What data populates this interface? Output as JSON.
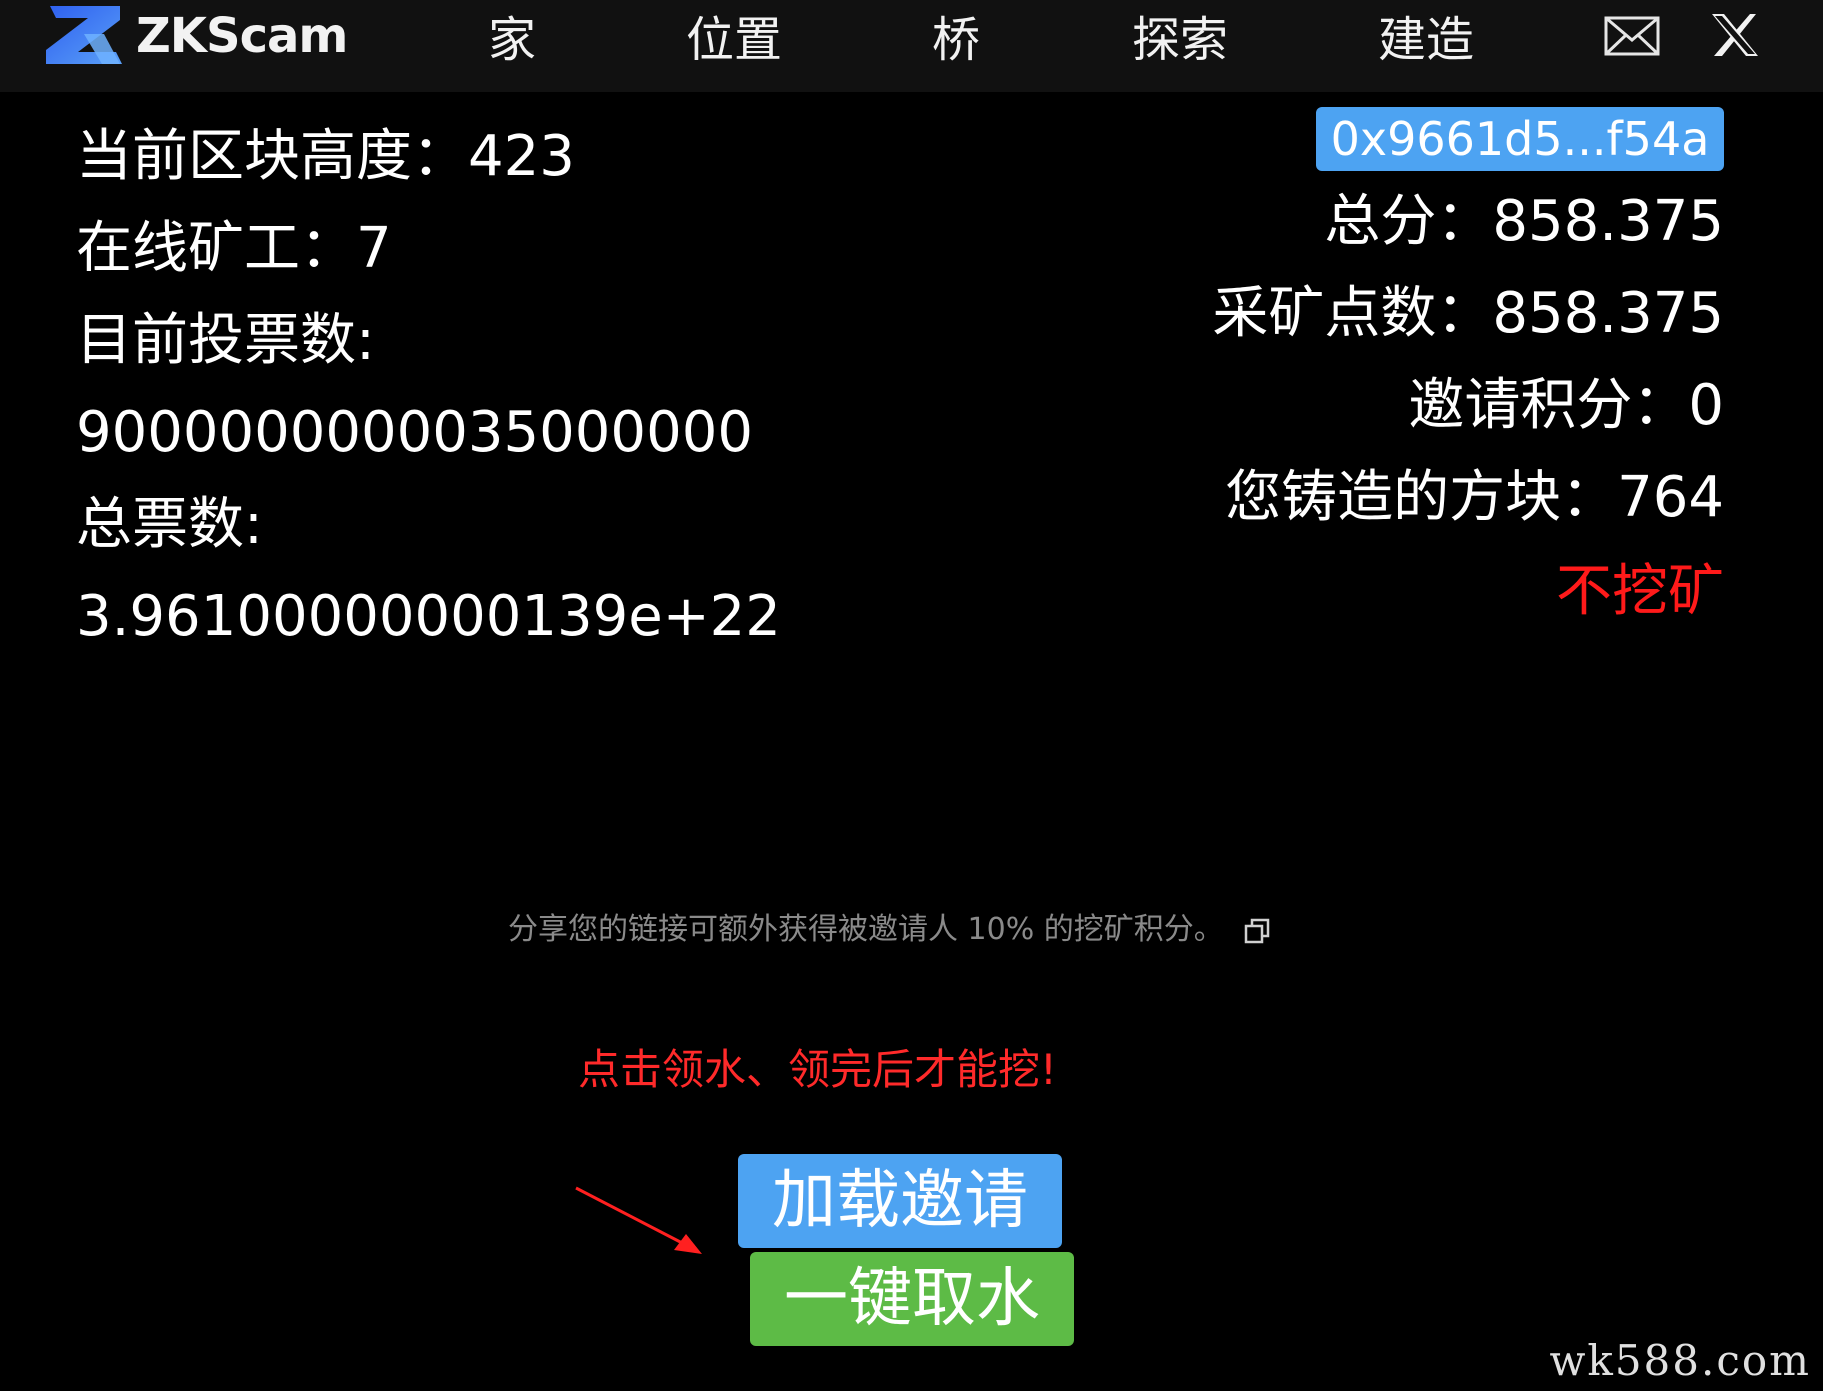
{
  "header": {
    "brand": "ZKScam",
    "nav": [
      "家",
      "位置",
      "桥",
      "探索",
      "建造"
    ],
    "icons": [
      "zkscam-logo-icon",
      "mail-icon",
      "x-icon"
    ]
  },
  "stats_left": {
    "block_height": "当前区块高度：423",
    "online_miners": "在线矿工：7",
    "current_votes_label": "目前投票数:",
    "current_votes_value": "9000000000035000000",
    "total_votes_label": "总票数:",
    "total_votes_value": "3.96100000000139e+22"
  },
  "stats_right": {
    "wallet": "0x9661d5...f54a",
    "total_score": "总分：858.375",
    "mining_points": "采矿点数：858.375",
    "invite_points": "邀请积分：0",
    "blocks_minted": "您铸造的方块：764",
    "mining_status": "不挖矿"
  },
  "share": {
    "text": "分享您的链接可额外获得被邀请人 10% 的挖矿积分。"
  },
  "warning": "点击领水、领完后才能挖!",
  "buttons": {
    "load_invite": "加载邀请",
    "one_click_faucet": "一键取水"
  },
  "watermark": "wk588.com",
  "colors": {
    "background": "#000000",
    "topbar": "#111111",
    "accent_blue": "#4da3f2",
    "accent_green": "#5dbb46",
    "alert_red": "#ff1a1a",
    "muted_text": "#8a8a8a",
    "logo_blue": "#3d7bf0"
  }
}
